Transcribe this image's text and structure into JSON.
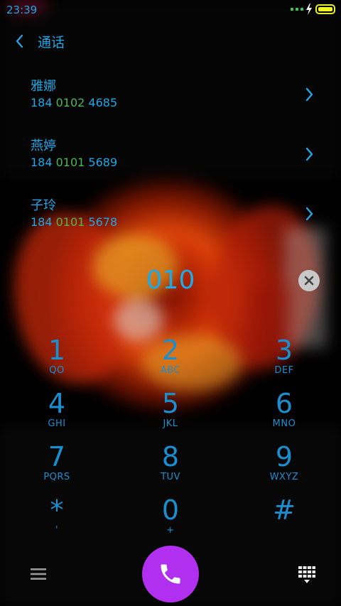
{
  "status_bar": {
    "time": "23:39"
  },
  "header": {
    "title": "通话"
  },
  "contacts": [
    {
      "name": "雅娜",
      "number_prefix": "184 ",
      "number_match": "0102",
      "number_suffix": " 4685"
    },
    {
      "name": "燕婷",
      "number_prefix": "184 ",
      "number_match": "0101",
      "number_suffix": " 5689"
    },
    {
      "name": "子玲",
      "number_prefix": "184 ",
      "number_match": "0101",
      "number_suffix": " 5678"
    }
  ],
  "dialer": {
    "display": "010",
    "keys": [
      {
        "digit": "1",
        "letters": "QO"
      },
      {
        "digit": "2",
        "letters": "ABC"
      },
      {
        "digit": "3",
        "letters": "DEF"
      },
      {
        "digit": "4",
        "letters": "GHI"
      },
      {
        "digit": "5",
        "letters": "JKL"
      },
      {
        "digit": "6",
        "letters": "MNO"
      },
      {
        "digit": "7",
        "letters": "PQRS"
      },
      {
        "digit": "8",
        "letters": "TUV"
      },
      {
        "digit": "9",
        "letters": "WXYZ"
      },
      {
        "digit": "*",
        "letters": "'"
      },
      {
        "digit": "0",
        "letters": "+"
      },
      {
        "digit": "#",
        "letters": ""
      }
    ]
  },
  "colors": {
    "accent": "#1fa7e6",
    "match_highlight": "#4cb84f",
    "call_button": "#b130ef",
    "battery": "#f2f720"
  },
  "icons": {
    "back": "chevron-left-icon",
    "contact_arrow": "chevron-right-icon",
    "clear": "close-icon",
    "menu": "menu-icon",
    "call": "phone-icon",
    "keypad": "dialpad-icon"
  }
}
